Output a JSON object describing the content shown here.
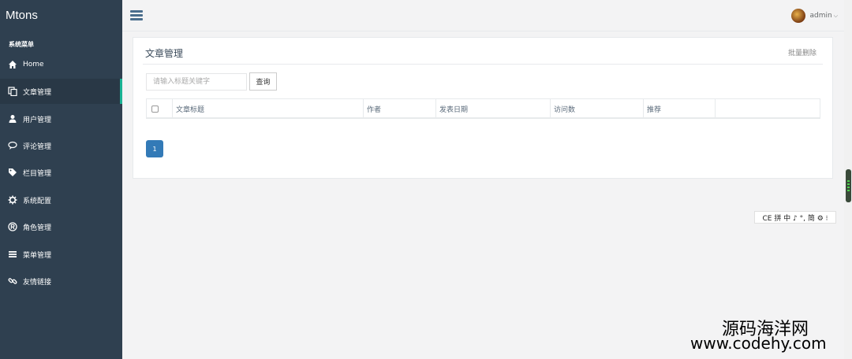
{
  "sidebar": {
    "brand": "Mtons",
    "menu_title": "系统菜单",
    "items": [
      {
        "label": "Home",
        "icon": "home-icon"
      },
      {
        "label": "文章管理",
        "icon": "copy-icon",
        "active": true
      },
      {
        "label": "用户管理",
        "icon": "user-icon"
      },
      {
        "label": "评论管理",
        "icon": "comment-icon"
      },
      {
        "label": "栏目管理",
        "icon": "tags-icon"
      },
      {
        "label": "系统配置",
        "icon": "gear-icon"
      },
      {
        "label": "角色管理",
        "icon": "registered-icon"
      },
      {
        "label": "菜单管理",
        "icon": "list-icon"
      },
      {
        "label": "友情链接",
        "icon": "link-icon"
      }
    ],
    "accent": "#1ab394",
    "background": "#2f4050"
  },
  "header": {
    "user": "admin",
    "caret": "⌵"
  },
  "main": {
    "title": "文章管理",
    "batch_delete": "批量删除",
    "search": {
      "placeholder": "请输入标题关键字",
      "button": "查询"
    },
    "table": {
      "columns": [
        "文章标题",
        "作者",
        "发表日期",
        "访问数",
        "推荐",
        ""
      ]
    },
    "pagination": {
      "current": "1"
    }
  },
  "ime_bar": "CE 拼 中 ♪ °, 简 ⚙ ⁝",
  "watermark": {
    "line1": "源码海洋网",
    "line2": "www.codehy.com"
  }
}
